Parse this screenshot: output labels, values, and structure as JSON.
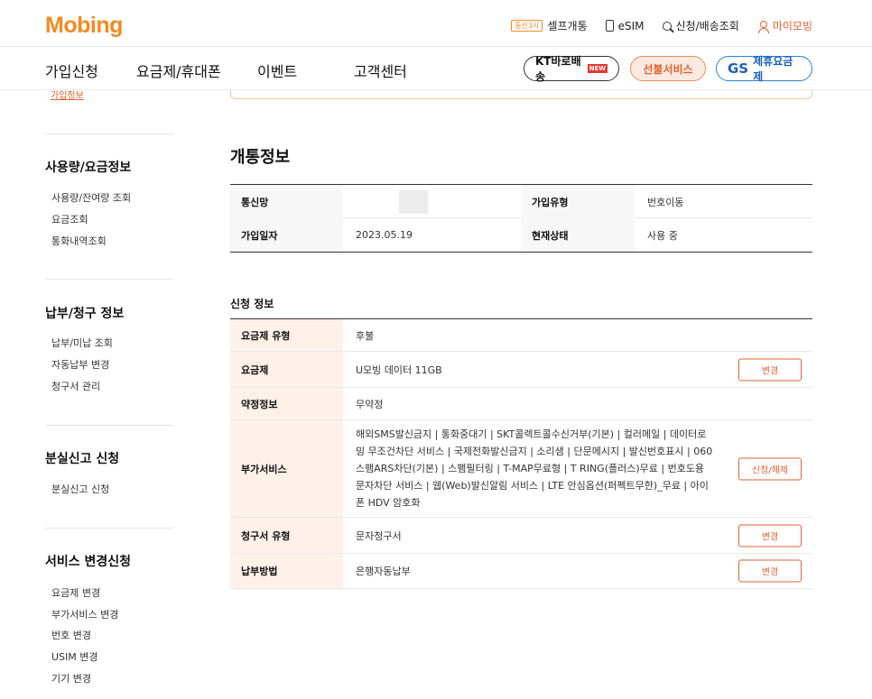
{
  "header": {
    "logo": "Mobing",
    "links": [
      {
        "badge": "통신3사",
        "label": "셀프개통",
        "icon": "badge-check-icon"
      },
      {
        "label": "eSIM",
        "icon": "phone-icon"
      },
      {
        "label": "신청/배송조회",
        "icon": "search-icon"
      },
      {
        "label": "마이모빙",
        "icon": "user-icon"
      }
    ]
  },
  "nav": {
    "items": [
      "가입신청",
      "요금제/휴대폰",
      "이벤트",
      "고객센터"
    ],
    "kt": {
      "label": "KT바로배송",
      "badge": "NEW"
    },
    "prepaid": "선불서비스",
    "gs": {
      "mark": "GS",
      "label": "제휴요금제"
    }
  },
  "sidebar": {
    "cut_item": "가입정보",
    "groups": [
      {
        "title": "사용량/요금정보",
        "links": [
          "사용량/잔여량 조회",
          "요금조회",
          "통화내역조회"
        ]
      },
      {
        "title": "납부/청구 정보",
        "links": [
          "납부/미납 조회",
          "자동납부 변경",
          "청구서 관리"
        ]
      },
      {
        "title": "분실신고 신청",
        "links": [
          "분실신고 신청"
        ]
      },
      {
        "title": "서비스 변경신청",
        "links": [
          "요금제 변경",
          "부가서비스 변경",
          "번호 변경",
          "USIM 변경",
          "기기 변경"
        ]
      }
    ]
  },
  "activation": {
    "title": "개통정보",
    "rows": [
      {
        "h1": "통신망",
        "v1": "",
        "h2": "가입유형",
        "v2": "번호이동"
      },
      {
        "h1": "가입일자",
        "v1": "2023.05.19",
        "h2": "현재상태",
        "v2": "사용 중"
      }
    ]
  },
  "application": {
    "title": "신청 정보",
    "rows": [
      {
        "label": "요금제 유형",
        "value": "후불",
        "button": ""
      },
      {
        "label": "요금제",
        "value": "U모빙 데이터 11GB",
        "button": "변경"
      },
      {
        "label": "약정정보",
        "value": "무약정",
        "button": ""
      },
      {
        "label": "부가서비스",
        "value": "해외SMS발신금지 | 통화중대기 | SKT콜렉트콜수신거부(기본) | 컬러메일 | 데이터로밍 무조건차단 서비스 | 국제전화발신금지 | 소리샘 | 단문메시지 | 발신번호표시 | 060스팸ARS차단(기본) | 스팸필터링 | T-MAP무료형 | T RING(플러스)무료 | 번호도용 문자차단 서비스 | 웹(Web)발신알림 서비스 | LTE 안심옵션(퍼펙트무한)_무료 | 아이폰 HDV 암호화",
        "button": "신청/해제"
      },
      {
        "label": "청구서 유형",
        "value": "문자청구서",
        "button": "변경"
      },
      {
        "label": "납부방법",
        "value": "은행자동납부",
        "button": "변경"
      }
    ]
  }
}
